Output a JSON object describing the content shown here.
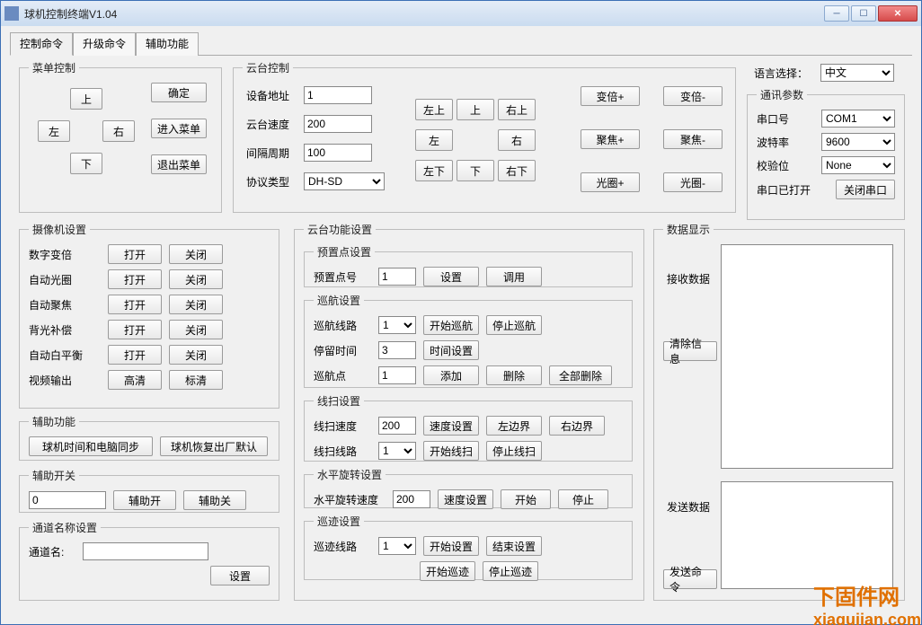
{
  "window": {
    "title": "球机控制终端V1.04"
  },
  "tabs": [
    "控制命令",
    "升级命令",
    "辅助功能"
  ],
  "menuControl": {
    "legend": "菜单控制",
    "up": "上",
    "down": "下",
    "left": "左",
    "right": "右",
    "ok": "确定",
    "enter": "进入菜单",
    "exit": "退出菜单"
  },
  "ptz": {
    "legend": "云台控制",
    "addr_label": "设备地址",
    "addr": "1",
    "speed_label": "云台速度",
    "speed": "200",
    "interval_label": "间隔周期",
    "interval": "100",
    "proto_label": "协议类型",
    "proto": "DH-SD",
    "lu": "左上",
    "u": "上",
    "ru": "右上",
    "l": "左",
    "r": "右",
    "ld": "左下",
    "d": "下",
    "rd": "右下",
    "zoomP": "变倍+",
    "zoomM": "变倍-",
    "focusP": "聚焦+",
    "focusM": "聚焦-",
    "irisP": "光圈+",
    "irisM": "光圈-"
  },
  "lang": {
    "label": "语言选择：",
    "value": "中文"
  },
  "comm": {
    "legend": "通讯参数",
    "com_label": "串口号",
    "com": "COM1",
    "baud_label": "波特率",
    "baud": "9600",
    "parity_label": "校验位",
    "parity": "None",
    "status": "串口已打开",
    "close": "关闭串口"
  },
  "cam": {
    "legend": "摄像机设置",
    "rows": [
      "数字变倍",
      "自动光圈",
      "自动聚焦",
      "背光补偿",
      "自动白平衡",
      "视频输出"
    ],
    "open": "打开",
    "close": "关闭",
    "hd": "高清",
    "sd": "标清"
  },
  "aux1": {
    "legend": "辅助功能",
    "time_sync": "球机时间和电脑同步",
    "factory": "球机恢复出厂默认"
  },
  "aux2": {
    "legend": "辅助开关",
    "value": "0",
    "on": "辅助开",
    "off": "辅助关"
  },
  "channel": {
    "legend": "通道名称设置",
    "name_label": "通道名:",
    "name": "",
    "set": "设置"
  },
  "ptzfunc": {
    "legend": "云台功能设置",
    "preset": {
      "legend": "预置点设置",
      "num_label": "预置点号",
      "num": "1",
      "set": "设置",
      "call": "调用"
    },
    "cruise": {
      "legend": "巡航设置",
      "line_label": "巡航线路",
      "line": "1",
      "start": "开始巡航",
      "stop": "停止巡航",
      "stay_label": "停留时间",
      "stay": "3",
      "time_set": "时间设置",
      "point_label": "巡航点",
      "point": "1",
      "add": "添加",
      "del": "删除",
      "del_all": "全部删除"
    },
    "linescan": {
      "legend": "线扫设置",
      "speed_label": "线扫速度",
      "speed": "200",
      "speed_set": "速度设置",
      "left": "左边界",
      "right": "右边界",
      "line_label": "线扫线路",
      "line": "1",
      "start": "开始线扫",
      "stop": "停止线扫"
    },
    "hrotate": {
      "legend": "水平旋转设置",
      "speed_label": "水平旋转速度",
      "speed": "200",
      "speed_set": "速度设置",
      "start": "开始",
      "stop": "停止"
    },
    "trace": {
      "legend": "巡迹设置",
      "line_label": "巡迹线路",
      "line": "1",
      "start_set": "开始设置",
      "end_set": "结束设置",
      "start": "开始巡迹",
      "stop": "停止巡迹"
    }
  },
  "datadisp": {
    "legend": "数据显示",
    "recv_label": "接收数据",
    "clear": "清除信息",
    "send_label": "发送数据",
    "send": "发送命令"
  },
  "watermark": {
    "l1": "下固件网",
    "l2": "xiagujian.com"
  }
}
